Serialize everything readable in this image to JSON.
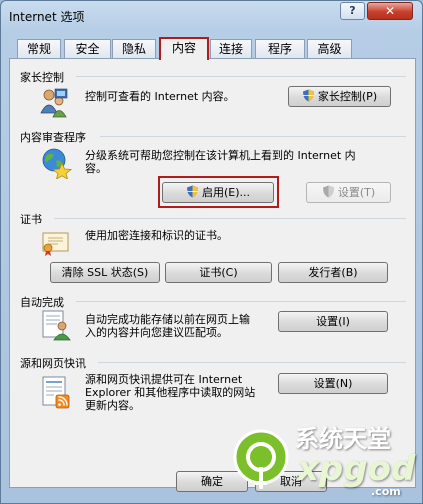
{
  "window": {
    "title": "Internet 选项",
    "help_label": "?",
    "close_label": "✕"
  },
  "tabs": [
    "常规",
    "安全",
    "隐私",
    "内容",
    "连接",
    "程序",
    "高级"
  ],
  "active_tab": "内容",
  "parental": {
    "title": "家长控制",
    "desc": "控制可查看的 Internet 内容。",
    "button": "家长控制(P)"
  },
  "advisor": {
    "title": "内容审查程序",
    "desc_line1": "分级系统可帮助您控制在该计算机上看到的 Internet 内",
    "desc_line2": "容。",
    "enable_button": "启用(E)...",
    "settings_button": "设置(T)"
  },
  "certificates": {
    "title": "证书",
    "desc": "使用加密连接和标识的证书。",
    "clear_ssl": "清除 SSL 状态(S)",
    "certs": "证书(C)",
    "publishers": "发行者(B)"
  },
  "autocomplete": {
    "title": "自动完成",
    "desc_line1": "自动完成功能存储以前在网页上输",
    "desc_line2": "入的内容并向您建议匹配项。",
    "button": "设置(I)"
  },
  "feeds": {
    "title": "源和网页快讯",
    "desc_line1": "源和网页快讯提供可在 Internet",
    "desc_line2": "Explorer 和其他程序中读取的网站",
    "desc_line3": "更新内容。",
    "button": "设置(N)"
  },
  "footer": {
    "ok": "确定",
    "cancel": "取消"
  },
  "watermark": {
    "text1": "系统天堂",
    "text2": "xpgod",
    "text3": ".com"
  },
  "colors": {
    "highlight": "#b01c1c",
    "titlebar": "#b6cde6",
    "close": "#c7402b"
  }
}
